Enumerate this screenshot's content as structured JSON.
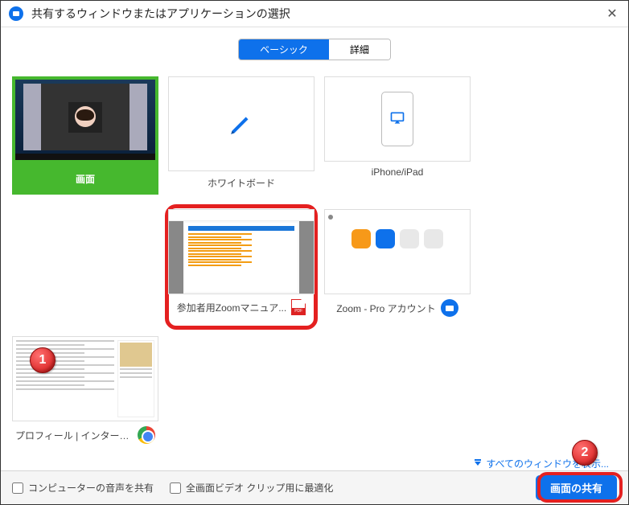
{
  "titlebar": {
    "title": "共有するウィンドウまたはアプリケーションの選択"
  },
  "tabs": {
    "basic": "ベーシック",
    "advanced": "詳細"
  },
  "tiles": {
    "screen": "画面",
    "whiteboard": "ホワイトボード",
    "iphone_ipad": "iPhone/iPad",
    "pdf": "参加者用Zoomマニュア...",
    "zoom_account": "Zoom - Pro アカウント",
    "profile": "プロフィール | インターネッ..."
  },
  "show_all": "すべてのウィンドウを表示...",
  "footer": {
    "share_audio": "コンピューターの音声を共有",
    "optimize_video": "全画面ビデオ クリップ用に最適化",
    "share_button": "画面の共有"
  },
  "callouts": {
    "one": "1",
    "two": "2"
  }
}
